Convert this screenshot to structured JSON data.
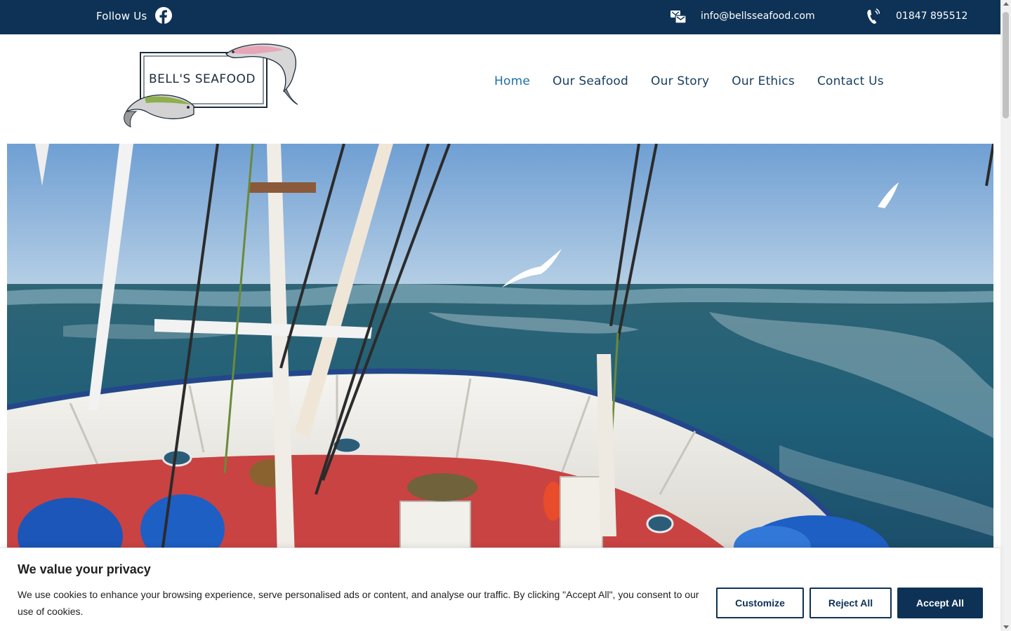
{
  "topbar": {
    "follow_label": "Follow Us",
    "email": "info@bellsseafood.com",
    "phone": "01847 895512",
    "background": "#0e3256"
  },
  "logo": {
    "text": "BELL'S SEAFOOD"
  },
  "nav": {
    "items": [
      {
        "label": "Home",
        "active": true
      },
      {
        "label": "Our Seafood",
        "active": false
      },
      {
        "label": "Our Story",
        "active": false
      },
      {
        "label": "Our Ethics",
        "active": false
      },
      {
        "label": "Contact Us",
        "active": false
      }
    ]
  },
  "cookie": {
    "title": "We value your privacy",
    "text": "We use cookies to enhance your browsing experience, serve personalised ads or content, and analyse our traffic. By clicking \"Accept All\", you consent to our use of cookies.",
    "customize_label": "Customize",
    "reject_label": "Reject All",
    "accept_label": "Accept All"
  },
  "colors": {
    "brand": "#0e3256",
    "nav_text": "#163d5f",
    "nav_active": "#1f6fa6"
  }
}
